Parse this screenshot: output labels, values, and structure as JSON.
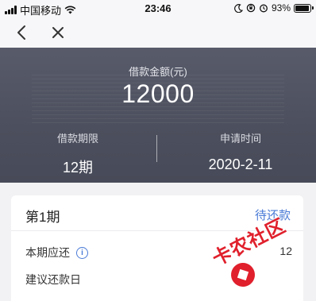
{
  "status_bar": {
    "carrier": "中国移动",
    "time": "23:46",
    "battery_percent": "93%",
    "battery_level": 0.93
  },
  "nav": {
    "back_icon": "chevron-left-icon",
    "close_icon": "close-icon"
  },
  "loan": {
    "amount_label": "借款金额(元)",
    "amount": "12000",
    "term_label": "借款期限",
    "term_value": "12期",
    "apply_time_label": "申请时间",
    "apply_time_value": "2020-2-11"
  },
  "installment": {
    "period": "第1期",
    "status": "待还款",
    "due_label": "本期应还",
    "due_value": "12",
    "suggested_date_label": "建议还款日"
  },
  "watermark": {
    "text": "卡农社区"
  },
  "colors": {
    "accent": "#4a7bd6",
    "hero_bg": "#4e5160",
    "watermark": "#e0202c"
  }
}
